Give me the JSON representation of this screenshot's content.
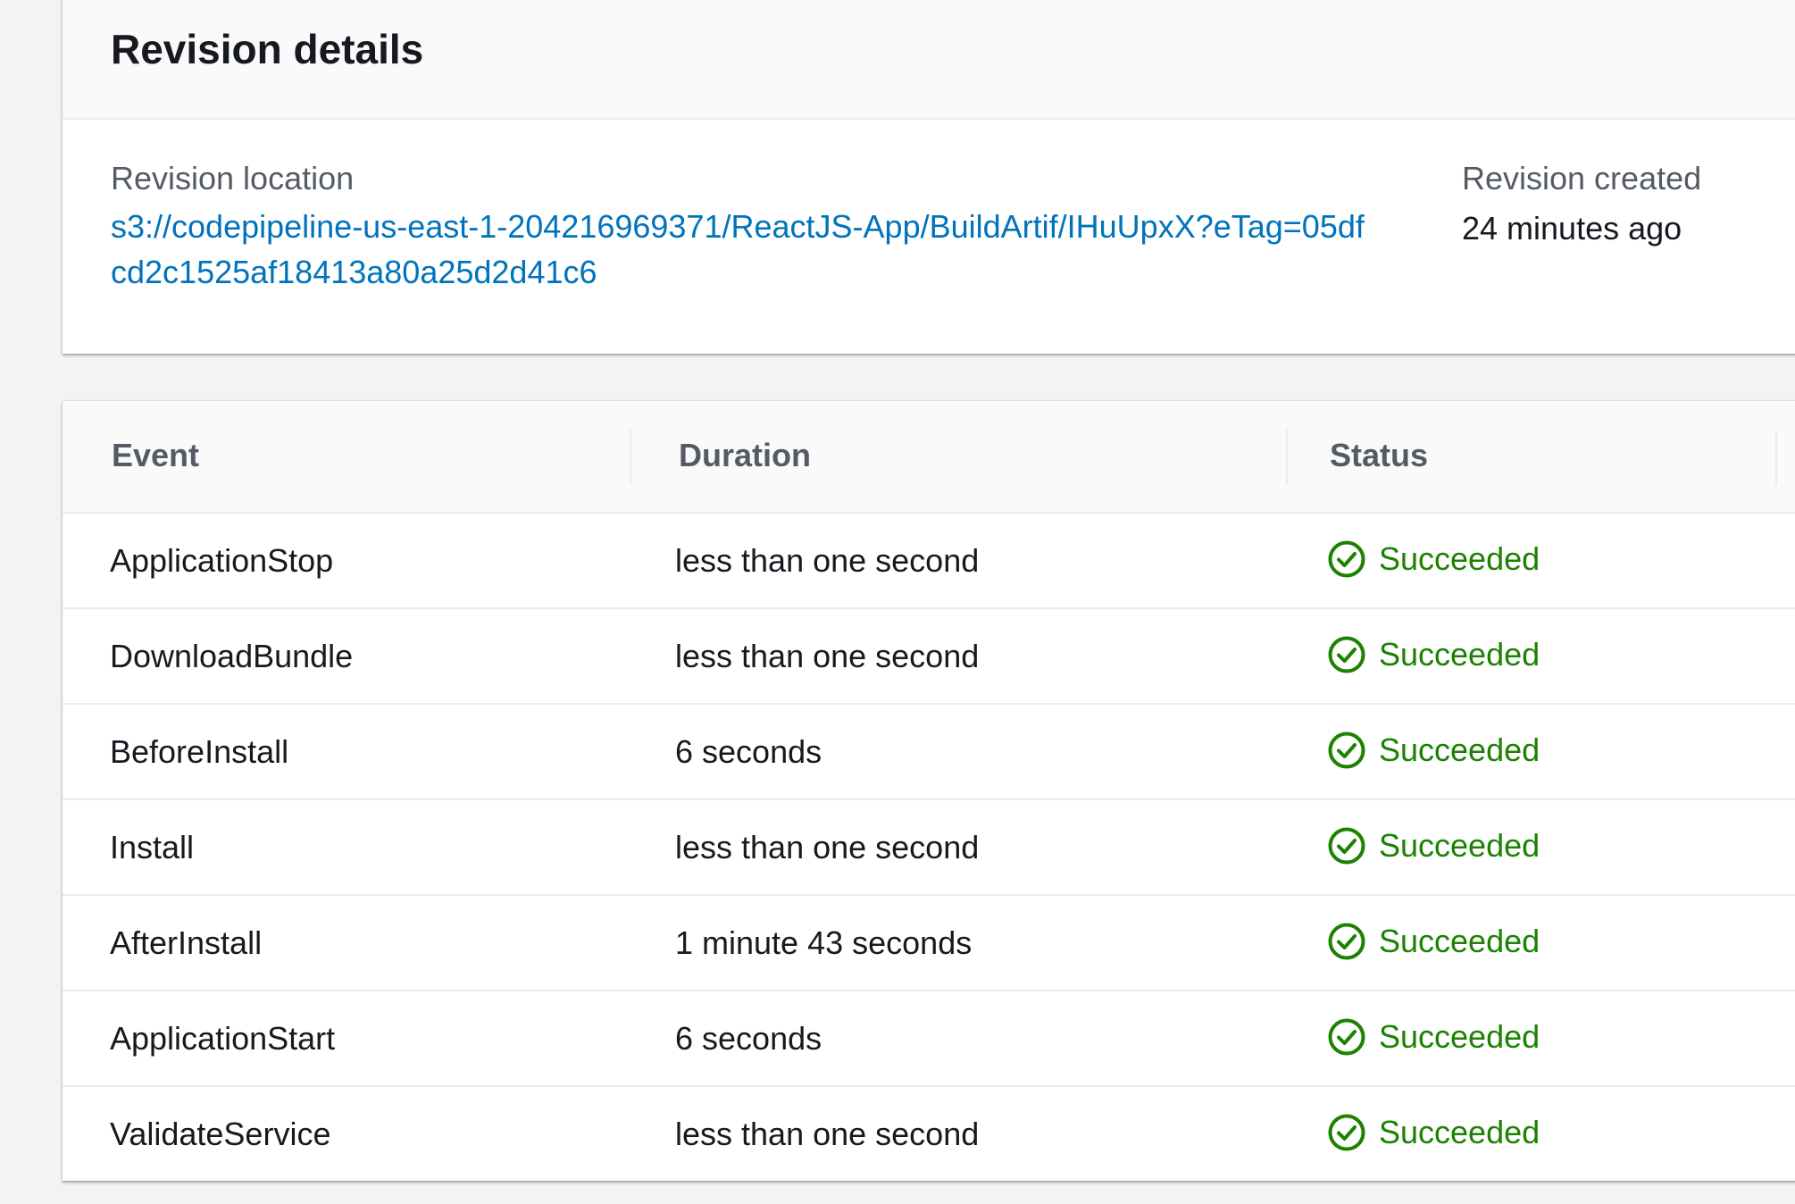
{
  "revision_panel": {
    "title": "Revision details",
    "location_label": "Revision location",
    "location_value": "s3://codepipeline-us-east-1-204216969371/ReactJS-App/BuildArtif/IHuUpxX?eTag=05dfcd2c1525af18413a80a25d2d41c6",
    "created_label": "Revision created",
    "created_value": "24 minutes ago"
  },
  "events_table": {
    "columns": [
      "Event",
      "Duration",
      "Status"
    ],
    "rows": [
      {
        "event": "ApplicationStop",
        "duration": "less than one second",
        "status": "Succeeded"
      },
      {
        "event": "DownloadBundle",
        "duration": "less than one second",
        "status": "Succeeded"
      },
      {
        "event": "BeforeInstall",
        "duration": "6 seconds",
        "status": "Succeeded"
      },
      {
        "event": "Install",
        "duration": "less than one second",
        "status": "Succeeded"
      },
      {
        "event": "AfterInstall",
        "duration": "1 minute 43 seconds",
        "status": "Succeeded"
      },
      {
        "event": "ApplicationStart",
        "duration": "6 seconds",
        "status": "Succeeded"
      },
      {
        "event": "ValidateService",
        "duration": "less than one second",
        "status": "Succeeded"
      }
    ]
  },
  "colors": {
    "link": "#0073bb",
    "success": "#1d8102",
    "label": "#545b64",
    "text": "#16191f"
  },
  "icons": {
    "status_success": "status-success-icon"
  }
}
